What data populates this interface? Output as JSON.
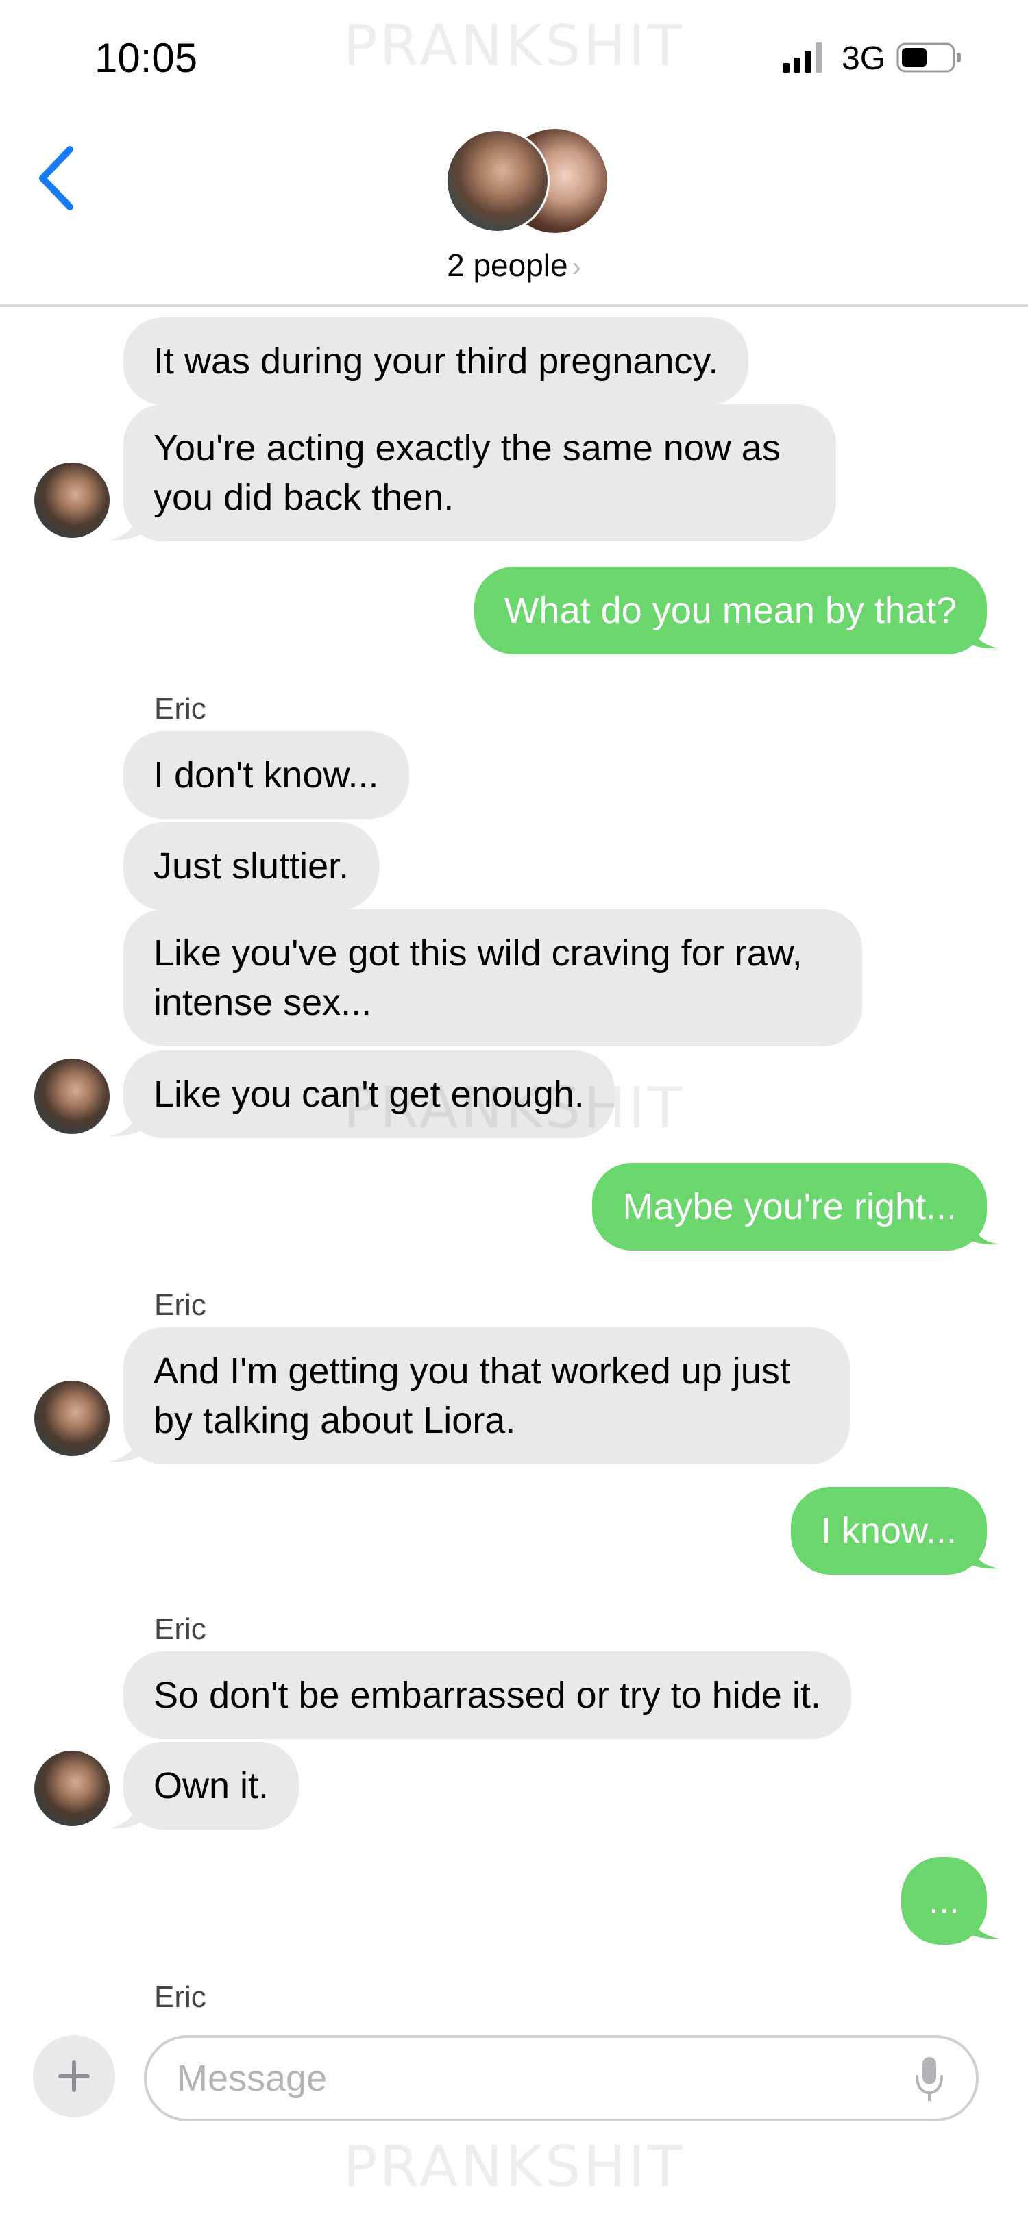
{
  "status_bar": {
    "time": "10:05",
    "network": "3G"
  },
  "watermark": "PRANKSHIT",
  "header": {
    "participants_label": "2 people",
    "chevron": "›"
  },
  "messages": [
    {
      "direction": "incoming",
      "text": "It was during your third pregnancy."
    },
    {
      "direction": "incoming",
      "text": "You're acting exactly the same now as you did back then."
    },
    {
      "direction": "outgoing",
      "text": "What do you mean by that?"
    },
    {
      "direction": "incoming",
      "sender": "Eric",
      "text": "I don't know..."
    },
    {
      "direction": "incoming",
      "text": "Just sluttier."
    },
    {
      "direction": "incoming",
      "text": "Like you've got this wild craving for raw, intense sex..."
    },
    {
      "direction": "incoming",
      "text": "Like you can't get enough."
    },
    {
      "direction": "outgoing",
      "text": "Maybe you're right..."
    },
    {
      "direction": "incoming",
      "sender": "Eric",
      "text": "And I'm getting you that worked up just by talking about Liora."
    },
    {
      "direction": "outgoing",
      "text": "I know..."
    },
    {
      "direction": "incoming",
      "sender": "Eric",
      "text": "So don't be embarrassed or try to hide it."
    },
    {
      "direction": "incoming",
      "text": "Own it."
    },
    {
      "direction": "outgoing",
      "text": "..."
    },
    {
      "direction": "incoming",
      "sender": "Eric",
      "text": ""
    }
  ],
  "composer": {
    "placeholder": "Message"
  },
  "colors": {
    "outgoing_bubble": "#6bd56e",
    "incoming_bubble": "#e9e9eb",
    "accent": "#1a7cf5"
  }
}
